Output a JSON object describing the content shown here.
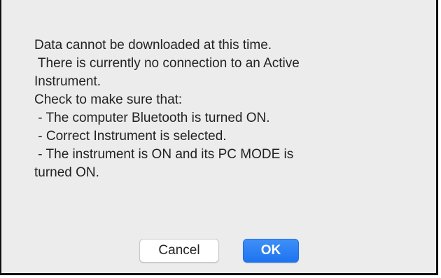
{
  "dialog": {
    "message_lines": [
      "Data cannot be downloaded at this time.",
      " There is currently no connection to an Active",
      "Instrument.",
      "Check to make sure that:",
      " - The computer Bluetooth is turned ON.",
      " - Correct Instrument is selected.",
      " - The instrument is ON and its PC MODE is",
      "turned ON."
    ],
    "buttons": {
      "cancel_label": "Cancel",
      "ok_label": "OK"
    }
  },
  "colors": {
    "dialog_background": "#ececec",
    "text": "#222222",
    "ok_button": "#2b7ff5",
    "cancel_button": "#ffffff",
    "frame": "#111111"
  }
}
